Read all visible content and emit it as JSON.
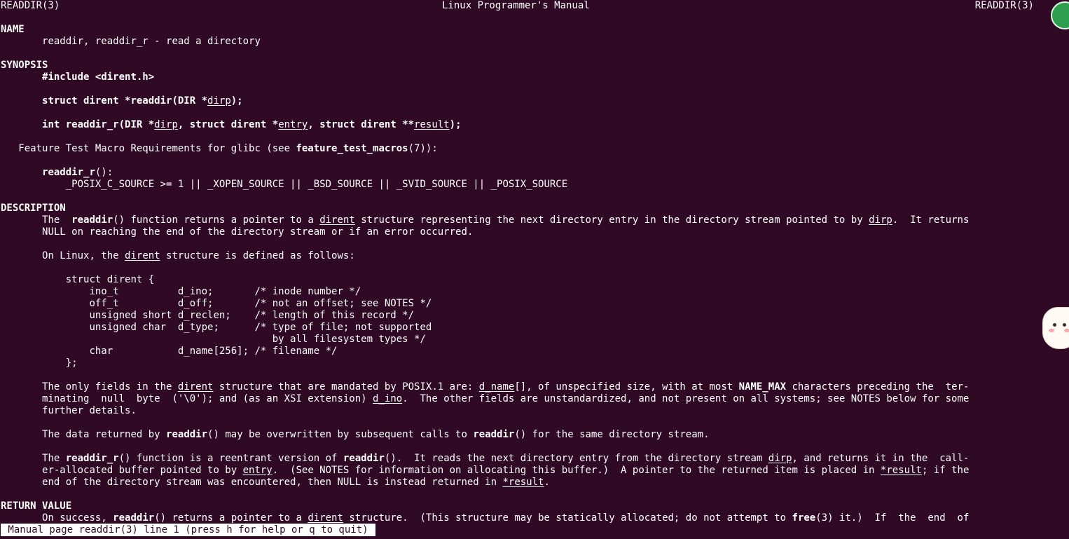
{
  "header": {
    "left": "READDIR(3)",
    "center": "Linux Programmer's Manual",
    "right": "READDIR(3)"
  },
  "sections": {
    "name_heading": "NAME",
    "name_text": "readdir, readdir_r - read a directory",
    "synopsis_heading": "SYNOPSIS",
    "include": "#include <dirent.h>",
    "proto1_bold": "struct dirent *readdir(DIR *",
    "proto1_arg": "dirp",
    "proto1_end": ");",
    "proto2_a": "int readdir_r(DIR *",
    "proto2_arg1": "dirp",
    "proto2_b": ", struct dirent *",
    "proto2_arg2": "entry",
    "proto2_c": ", struct dirent **",
    "proto2_arg3": "result",
    "proto2_end": ");",
    "ftm_pre": "Feature Test Macro Requirements for glibc (see ",
    "ftm_bold": "feature_test_macros",
    "ftm_post": "(7)):",
    "ftm_func": "readdir_r",
    "ftm_func_post": "():",
    "ftm_macros": "_POSIX_C_SOURCE >= 1 || _XOPEN_SOURCE || _BSD_SOURCE || _SVID_SOURCE || _POSIX_SOURCE",
    "description_heading": "DESCRIPTION",
    "desc1_a": "The  ",
    "desc1_b": "readdir",
    "desc1_c": "() function returns a pointer to a ",
    "desc1_d": "dirent",
    "desc1_e": " structure representing the next directory entry in the directory stream pointed to by ",
    "desc1_f": "dirp",
    "desc1_g": ".  It returns",
    "desc1_line2": "NULL on reaching the end of the directory stream or if an error occurred.",
    "desc2_a": "On Linux, the ",
    "desc2_b": "dirent",
    "desc2_c": " structure is defined as follows:",
    "struct_lines": [
      "    struct dirent {",
      "        ino_t          d_ino;       /* inode number */",
      "        off_t          d_off;       /* not an offset; see NOTES */",
      "        unsigned short d_reclen;    /* length of this record */",
      "        unsigned char  d_type;      /* type of file; not supported",
      "                                       by all filesystem types */",
      "        char           d_name[256]; /* filename */",
      "    };"
    ],
    "desc3_a": "The only fields in the ",
    "desc3_b": "dirent",
    "desc3_c": " structure that are mandated by POSIX.1 are: ",
    "desc3_d": "d_name",
    "desc3_e": "[], of unspecified size, with at most ",
    "desc3_f": "NAME_MAX",
    "desc3_g": " characters preceding the  ter‐",
    "desc3_l2a": "minating  null  byte  ('\\0'); and (as an XSI extension) ",
    "desc3_l2b": "d_ino",
    "desc3_l2c": ".  The other fields are unstandardized, and not present on all systems; see NOTES below for some",
    "desc3_l3": "further details.",
    "desc4_a": "The data returned by ",
    "desc4_b": "readdir",
    "desc4_c": "() may be overwritten by subsequent calls to ",
    "desc4_d": "readdir",
    "desc4_e": "() for the same directory stream.",
    "desc5_a": "The ",
    "desc5_b": "readdir_r",
    "desc5_c": "() function is a reentrant version of ",
    "desc5_d": "readdir",
    "desc5_e": "().  It reads the next directory entry from the directory stream ",
    "desc5_f": "dirp",
    "desc5_g": ", and returns it in the  call‐",
    "desc5_l2a": "er-allocated buffer pointed to by ",
    "desc5_l2b": "entry",
    "desc5_l2c": ".  (See NOTES for information on allocating this buffer.)  A pointer to the returned item is placed in ",
    "desc5_l2d": "*result",
    "desc5_l2e": "; if the",
    "desc5_l3a": "end of the directory stream was encountered, then NULL is instead returned in ",
    "desc5_l3b": "*result",
    "desc5_l3c": ".",
    "return_heading": "RETURN VALUE",
    "ret_a": "On success, ",
    "ret_b": "readdir",
    "ret_c": "() returns a pointer to a ",
    "ret_d": "dirent",
    "ret_e": " structure.  (This structure may be statically allocated; do not attempt to ",
    "ret_f": "free",
    "ret_g": "(3) it.)  If  the  end  of"
  },
  "status_bar": " Manual page readdir(3) line 1 (press h for help or q to quit) ",
  "colors": {
    "background": "#300a24",
    "foreground": "#ffffff"
  }
}
